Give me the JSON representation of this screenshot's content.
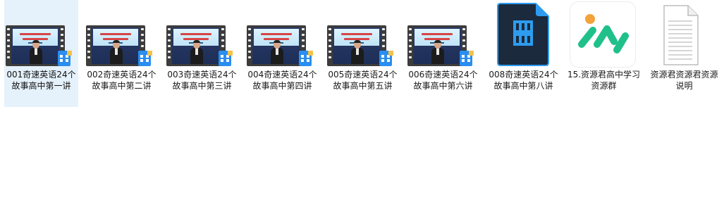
{
  "folder": {
    "items": [
      {
        "name": "001奇速英语24个故事高中第一讲",
        "type": "video",
        "selected": true
      },
      {
        "name": "002奇速英语24个故事高中第二讲",
        "type": "video",
        "selected": false
      },
      {
        "name": "003奇速英语24个故事高中第三讲",
        "type": "video",
        "selected": false
      },
      {
        "name": "004奇速英语24个故事高中第四讲",
        "type": "video",
        "selected": false
      },
      {
        "name": "005奇速英语24个故事高中第五讲",
        "type": "video",
        "selected": false
      },
      {
        "name": "006奇速英语24个故事高中第六讲",
        "type": "video",
        "selected": false
      },
      {
        "name": "008奇速英语24个故事高中第八讲",
        "type": "media-file",
        "selected": false
      },
      {
        "name": "15.资源君高中学习资源群",
        "type": "link",
        "selected": false
      },
      {
        "name": "资源君资源君资源说明",
        "type": "document",
        "selected": false
      }
    ],
    "icons": {
      "video": "video-thumbnail-icon",
      "media-file": "media-player-file-icon",
      "link": "app-shortcut-icon",
      "document": "text-document-icon"
    },
    "colors": {
      "selection_bg": "#e5f1fb",
      "media_icon_bg": "#1b2a3d",
      "media_icon_accent": "#2d9cf0",
      "app_green": "#20c08a",
      "app_orange": "#f2a33a"
    }
  }
}
